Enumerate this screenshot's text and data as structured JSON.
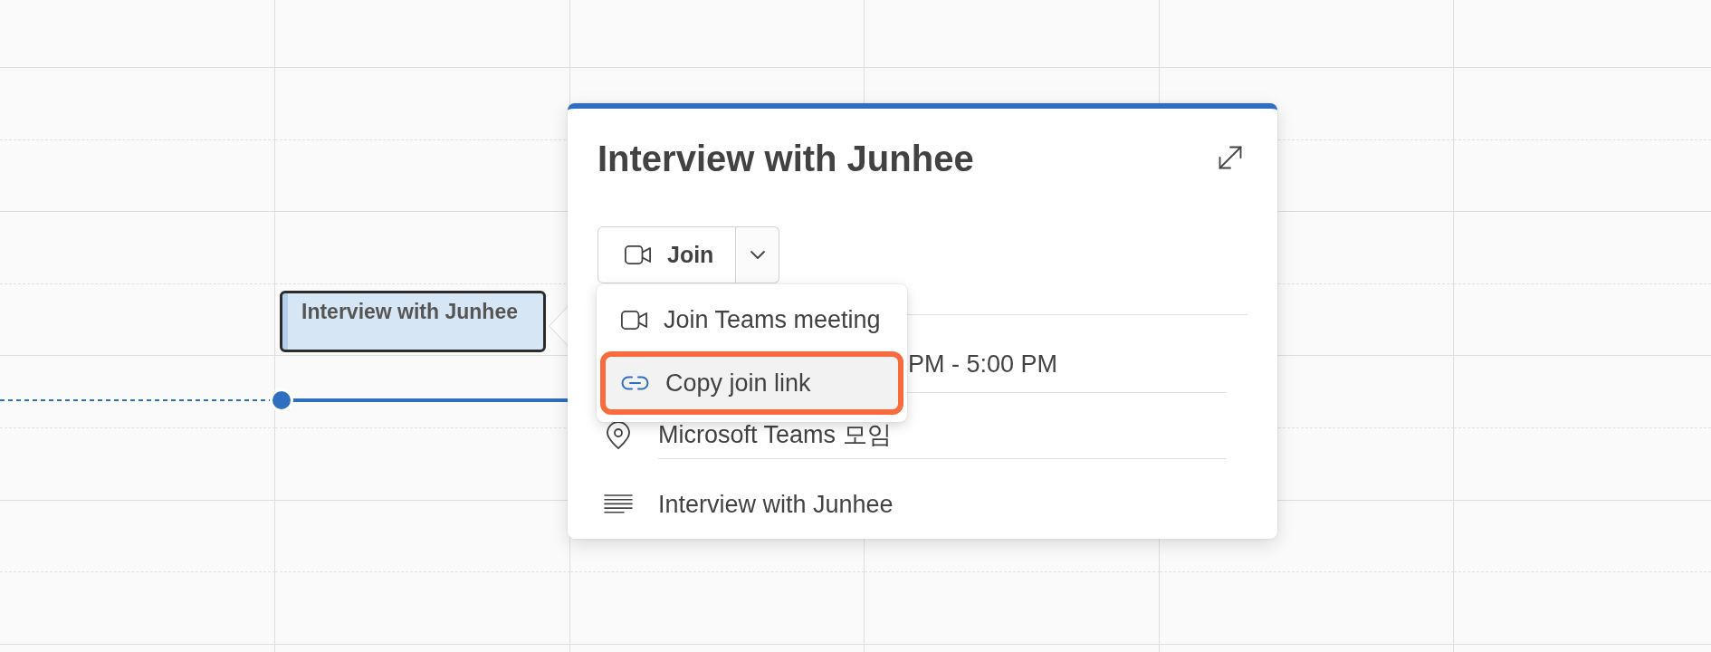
{
  "calendar_event": {
    "title": "Interview with Junhee",
    "selected": true
  },
  "popup": {
    "title": "Interview with Junhee",
    "join_button": {
      "label": "Join",
      "expanded": true
    },
    "join_menu": {
      "items": [
        {
          "kind": "video",
          "label": "Join Teams meeting",
          "selected": false
        },
        {
          "kind": "link",
          "label": "Copy join link",
          "selected": true
        }
      ]
    },
    "details": [
      {
        "kind": "time",
        "text": "PM - 5:00 PM"
      },
      {
        "kind": "location",
        "text": "Microsoft Teams 모임"
      },
      {
        "kind": "description",
        "text": "Interview with Junhee"
      }
    ]
  }
}
